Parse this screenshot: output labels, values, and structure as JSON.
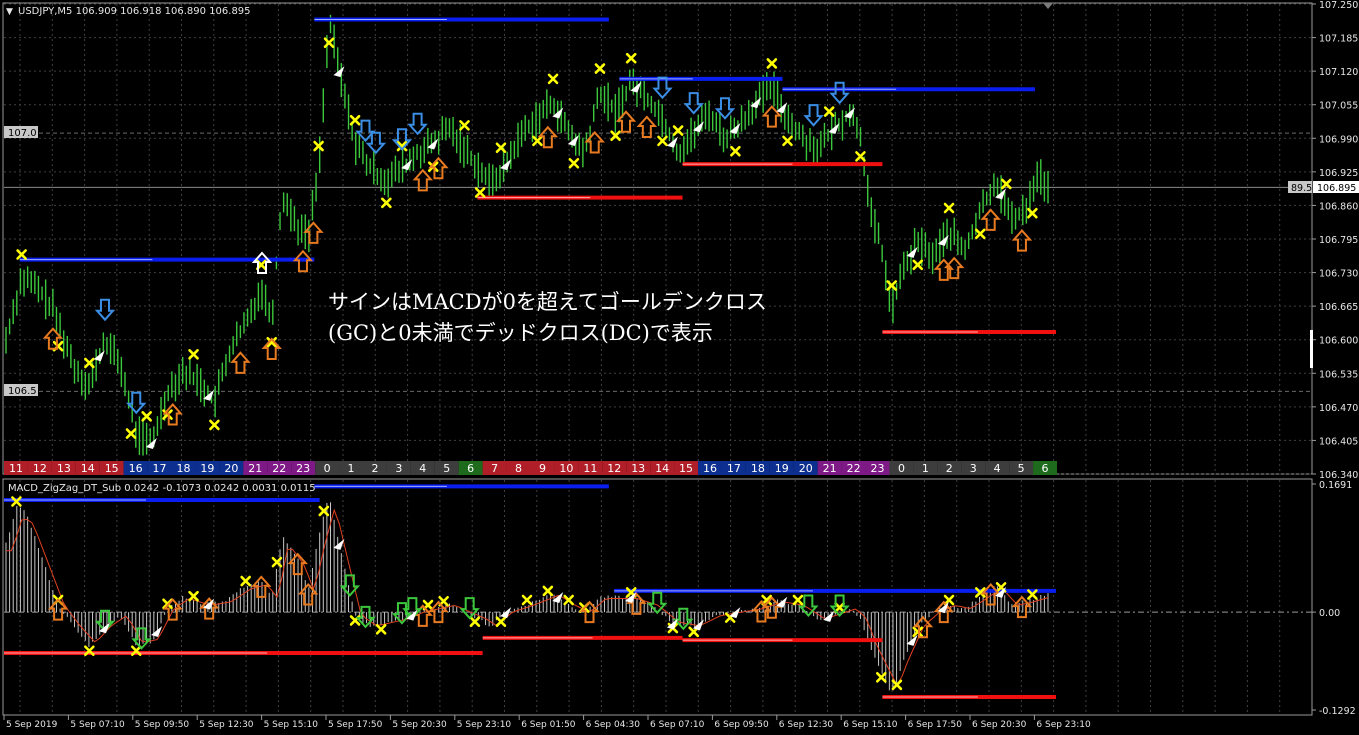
{
  "main_chart": {
    "header": "USDJPY,M5  106.909 106.918 106.890 106.895",
    "collapse_marker": "▼",
    "price_ticks": [
      "107.250",
      "107.185",
      "107.120",
      "107.055",
      "106.990",
      "106.925",
      "106.860",
      "106.795",
      "106.730",
      "106.665",
      "106.600",
      "106.535",
      "106.470",
      "106.405",
      "106.340"
    ],
    "price_range": [
      106.34,
      107.25
    ],
    "current_price": "106.895",
    "current_price_value": 106.895,
    "crosshair_label": "89.5",
    "level_labels": [
      {
        "text": "107.0",
        "value": 107.0
      },
      {
        "text": "106.5",
        "value": 106.5
      }
    ],
    "annotation_line1": "サインはMACDが0を超えてゴールデンクロス",
    "annotation_line2": "(GC)と0未満でデッドクロス(DC)で表示",
    "hour_bar": [
      {
        "label": "11",
        "color": "#b01e28"
      },
      {
        "label": "12",
        "color": "#b01e28"
      },
      {
        "label": "13",
        "color": "#b01e28"
      },
      {
        "label": "14",
        "color": "#b01e28"
      },
      {
        "label": "15",
        "color": "#b01e28"
      },
      {
        "label": "16",
        "color": "#0d2f8f"
      },
      {
        "label": "17",
        "color": "#0d2f8f"
      },
      {
        "label": "18",
        "color": "#0d2f8f"
      },
      {
        "label": "19",
        "color": "#0d2f8f"
      },
      {
        "label": "20",
        "color": "#0d2f8f"
      },
      {
        "label": "21",
        "color": "#7e1a86"
      },
      {
        "label": "22",
        "color": "#7e1a86"
      },
      {
        "label": "23",
        "color": "#7e1a86"
      },
      {
        "label": "0",
        "color": "#3d3d3d"
      },
      {
        "label": "1",
        "color": "#3d3d3d"
      },
      {
        "label": "2",
        "color": "#3d3d3d"
      },
      {
        "label": "3",
        "color": "#3d3d3d"
      },
      {
        "label": "4",
        "color": "#3d3d3d"
      },
      {
        "label": "5",
        "color": "#3d3d3d"
      },
      {
        "label": "6",
        "color": "#1e6b1e"
      },
      {
        "label": "7",
        "color": "#b01e28"
      },
      {
        "label": "8",
        "color": "#b01e28"
      },
      {
        "label": "9",
        "color": "#b01e28"
      },
      {
        "label": "10",
        "color": "#b01e28"
      },
      {
        "label": "11",
        "color": "#b01e28"
      },
      {
        "label": "12",
        "color": "#b01e28"
      },
      {
        "label": "13",
        "color": "#b01e28"
      },
      {
        "label": "14",
        "color": "#b01e28"
      },
      {
        "label": "15",
        "color": "#b01e28"
      },
      {
        "label": "16",
        "color": "#0d2f8f"
      },
      {
        "label": "17",
        "color": "#0d2f8f"
      },
      {
        "label": "18",
        "color": "#0d2f8f"
      },
      {
        "label": "19",
        "color": "#0d2f8f"
      },
      {
        "label": "20",
        "color": "#0d2f8f"
      },
      {
        "label": "21",
        "color": "#7e1a86"
      },
      {
        "label": "22",
        "color": "#7e1a86"
      },
      {
        "label": "23",
        "color": "#7e1a86"
      },
      {
        "label": "0",
        "color": "#3d3d3d"
      },
      {
        "label": "1",
        "color": "#3d3d3d"
      },
      {
        "label": "2",
        "color": "#3d3d3d"
      },
      {
        "label": "3",
        "color": "#3d3d3d"
      },
      {
        "label": "4",
        "color": "#3d3d3d"
      },
      {
        "label": "5",
        "color": "#3d3d3d"
      },
      {
        "label": "6",
        "color": "#1e6b1e"
      }
    ],
    "resistance_lines": [
      {
        "value": 107.22,
        "from": 0.295,
        "to": 0.575
      },
      {
        "value": 107.105,
        "from": 0.585,
        "to": 0.74
      },
      {
        "value": 107.085,
        "from": 0.74,
        "to": 0.98
      },
      {
        "value": 106.755,
        "from": 0.015,
        "to": 0.295
      }
    ],
    "support_lines": [
      {
        "value": 106.875,
        "from": 0.45,
        "to": 0.645
      },
      {
        "value": 106.94,
        "from": 0.645,
        "to": 0.835
      },
      {
        "value": 106.615,
        "from": 0.835,
        "to": 1.0
      }
    ]
  },
  "sub_chart": {
    "header": "MACD_ZigZag_DT_Sub 0.0242 -0.1073 0.0242 0.0031 0.0115",
    "axis_ticks": [
      "0.1691",
      "0.00",
      "-0.1292"
    ],
    "range": [
      -0.1292,
      0.1691
    ],
    "zero_level": 0.0,
    "resistance_lines": [
      {
        "value": 0.148,
        "from": 0.0,
        "to": 0.3
      },
      {
        "value": 0.166,
        "from": 0.295,
        "to": 0.575
      },
      {
        "value": 0.028,
        "from": 0.58,
        "to": 1.0
      }
    ],
    "support_lines": [
      {
        "value": -0.054,
        "from": 0.0,
        "to": 0.455
      },
      {
        "value": -0.034,
        "from": 0.455,
        "to": 0.645
      },
      {
        "value": -0.037,
        "from": 0.645,
        "to": 0.835
      },
      {
        "value": -0.112,
        "from": 0.835,
        "to": 1.0
      }
    ]
  },
  "time_axis": [
    "5 Sep 2019",
    "5 Sep 07:10",
    "5 Sep 09:50",
    "5 Sep 12:30",
    "5 Sep 15:10",
    "5 Sep 17:50",
    "5 Sep 20:30",
    "5 Sep 23:10",
    "6 Sep 01:50",
    "6 Sep 04:30",
    "6 Sep 07:10",
    "6 Sep 09:50",
    "6 Sep 12:30",
    "6 Sep 15:10",
    "6 Sep 17:50",
    "6 Sep 20:30",
    "6 Sep 23:10"
  ],
  "colors": {
    "candle": "#3cc83c",
    "grid": "#404040",
    "resistance": "#0a1ef0",
    "support": "#f01010",
    "zigzag_marker": "#ffff00",
    "buy_arrow": "#e87a20",
    "sell_arrow": "#3a8ee6",
    "sub_buy_arrow": "#3cc83c",
    "macd_line": "#e04020"
  }
}
